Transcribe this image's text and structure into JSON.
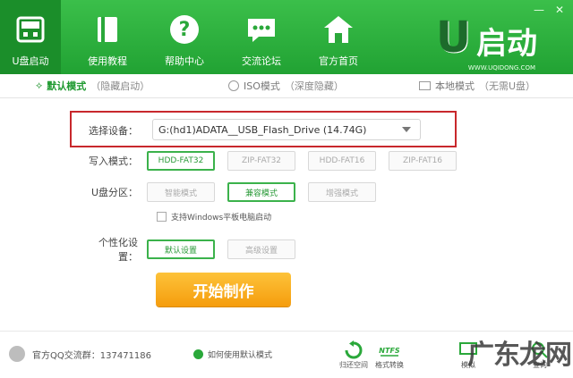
{
  "window": {
    "minimize_label": "—",
    "close_label": "✕"
  },
  "nav": {
    "items": [
      {
        "label": "U盘启动",
        "icon": "usb-drive-icon"
      },
      {
        "label": "使用教程",
        "icon": "book-icon"
      },
      {
        "label": "帮助中心",
        "icon": "help-icon"
      },
      {
        "label": "交流论坛",
        "icon": "chat-icon"
      },
      {
        "label": "官方首页",
        "icon": "home-icon"
      }
    ]
  },
  "logo": {
    "letter": "U",
    "text": "启动",
    "url": "WWW.UQIDONG.COM"
  },
  "tabs": [
    {
      "main": "默认模式",
      "sub": "（隐藏启动）"
    },
    {
      "main": "ISO模式",
      "sub": "（深度隐藏）"
    },
    {
      "main": "本地模式",
      "sub": "（无需U盘）"
    }
  ],
  "device": {
    "label": "选择设备：",
    "value": "G:(hd1)ADATA__USB_Flash_Drive (14.74G)"
  },
  "write_mode": {
    "label": "写入模式：",
    "options": [
      "HDD-FAT32",
      "ZIP-FAT32",
      "HDD-FAT16",
      "ZIP-FAT16"
    ],
    "selected": "HDD-FAT32"
  },
  "partition": {
    "label": "U盘分区：",
    "options": [
      "智能模式",
      "兼容模式",
      "增强模式"
    ],
    "selected": "兼容模式"
  },
  "tablet_checkbox": {
    "label": "支持Windows平板电脑启动",
    "checked": false
  },
  "personal": {
    "label": "个性化设置：",
    "options": [
      "默认设置",
      "高级设置"
    ],
    "selected": "默认设置"
  },
  "start_button": {
    "label": "开始制作"
  },
  "footer": {
    "qq_text": "官方QQ交流群：137471186",
    "howto_text": "如何使用默认模式",
    "tools": [
      {
        "label": "归还空间",
        "icon": "restore-icon"
      },
      {
        "label": "格式转换",
        "icon": "ntfs-icon",
        "icon_text": "NTFS"
      },
      {
        "label": "模拟",
        "icon": "simulate-icon"
      },
      {
        "label": "查询",
        "icon": "search-icon"
      }
    ]
  },
  "watermark": "广东龙网",
  "colors": {
    "header_green": "#21a233",
    "accent_green": "#2a9a38",
    "highlight_red": "#c8282c",
    "start_orange": "#f5a313"
  }
}
